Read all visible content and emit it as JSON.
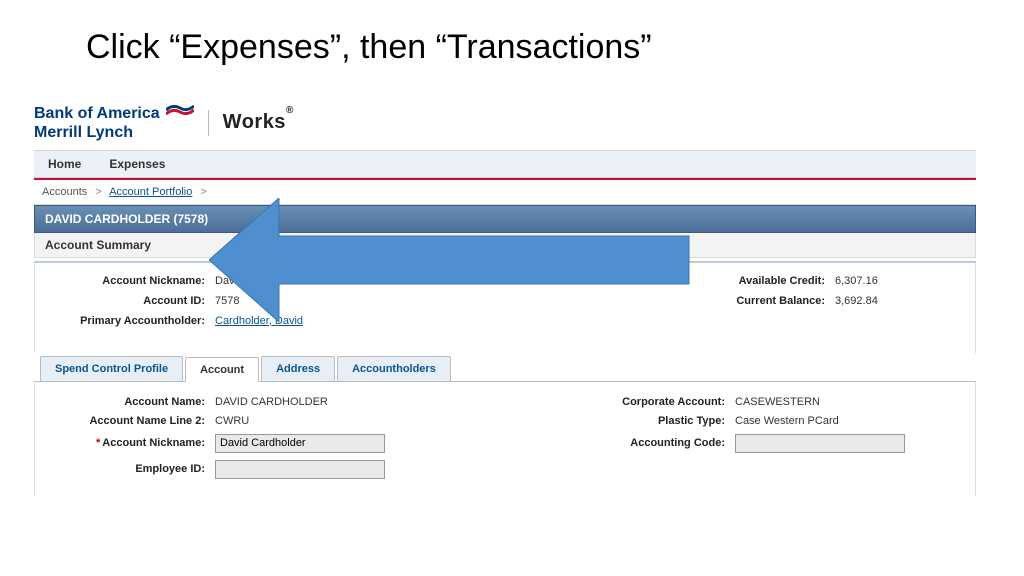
{
  "slide": {
    "title": "Click “Expenses”, then “Transactions”"
  },
  "branding": {
    "bank_line1": "Bank of America",
    "bank_line2": "Merrill Lynch",
    "app_name": "Works",
    "tm": "®"
  },
  "nav": {
    "home": "Home",
    "expenses": "Expenses"
  },
  "breadcrumb": {
    "accounts": "Accounts",
    "portfolio": "Account Portfolio"
  },
  "account": {
    "header": "DAVID CARDHOLDER (7578)",
    "summary_title": "Account Summary"
  },
  "summary": {
    "nickname_label": "Account Nickname:",
    "nickname_value": "David Cardholder",
    "id_label": "Account ID:",
    "id_value": "7578",
    "primary_label": "Primary Accountholder:",
    "primary_value": "Cardholder, David",
    "avail_credit_label": "Available Credit:",
    "avail_credit_value": "6,307.16",
    "balance_label": "Current Balance:",
    "balance_value": "3,692.84"
  },
  "tabs": {
    "spend": "Spend Control Profile",
    "account": "Account",
    "address": "Address",
    "holders": "Accountholders"
  },
  "form": {
    "account_name_label": "Account Name:",
    "account_name_value": "DAVID CARDHOLDER",
    "name_line2_label": "Account Name Line 2:",
    "name_line2_value": "CWRU",
    "nickname_label": "Account Nickname:",
    "nickname_value": "David Cardholder",
    "employee_id_label": "Employee ID:",
    "employee_id_value": "",
    "corp_account_label": "Corporate Account:",
    "corp_account_value": "CASEWESTERN",
    "plastic_label": "Plastic Type:",
    "plastic_value": "Case Western PCard",
    "acct_code_label": "Accounting Code:",
    "acct_code_value": ""
  }
}
